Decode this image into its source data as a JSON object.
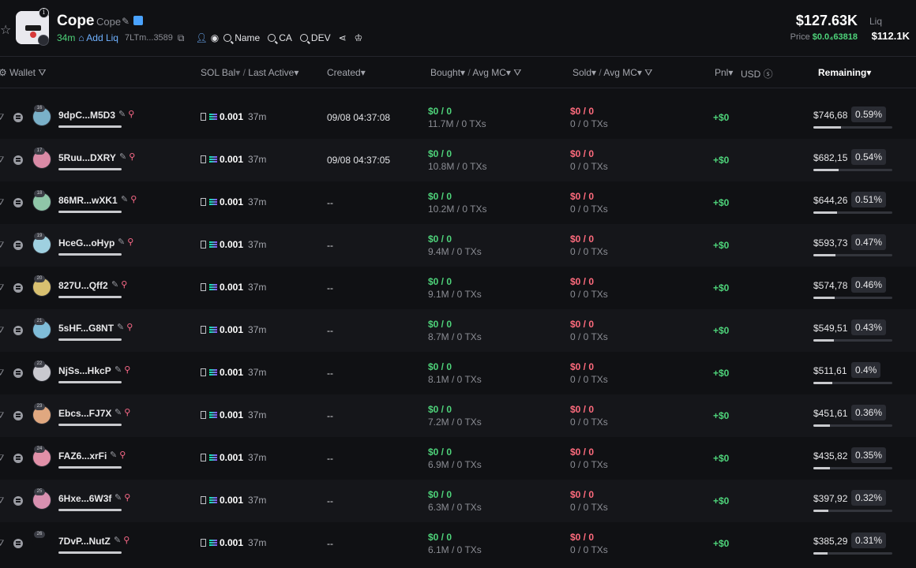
{
  "header": {
    "token_name": "Cope",
    "token_ticker": "Cope",
    "age": "34m",
    "add_liq": "Add Liq",
    "address": "7LTm...3589",
    "btn_name": "Name",
    "btn_ca": "CA",
    "btn_dev": "DEV",
    "market_cap": "$127.63K",
    "liq_label": "Liq",
    "price_label": "Price",
    "price_value": "$0.0₄63818",
    "liquidity": "$112.1K"
  },
  "columns": {
    "wallet": "Wallet",
    "sol_bal": "SOL Bal",
    "sep": "/",
    "last_active": "Last Active",
    "created": "Created",
    "bought": "Bought",
    "avg_mc": "Avg MC",
    "sold": "Sold",
    "pnl": "Pnl",
    "usd": "USD",
    "remaining": "Remaining"
  },
  "colors": {
    "positive": "#4ed37a",
    "negative": "#ff6b7d",
    "link": "#6fb1ff",
    "background": "#101114"
  },
  "rows": [
    {
      "rank": "16",
      "wallet": "9dpC...M5D3",
      "sol": "0.001",
      "active": "37m",
      "created": "09/08 04:37:08",
      "bought": "$0 / 0",
      "bought_sub": "11.7M / 0 TXs",
      "sold": "$0 / 0",
      "sold_sub": "0 / 0 TXs",
      "pnl": "+$0",
      "remaining": "$746,68",
      "pct": "0.59%",
      "fill": 0.59,
      "color": "#7ab0c8"
    },
    {
      "rank": "17",
      "wallet": "5Ruu...DXRY",
      "sol": "0.001",
      "active": "37m",
      "created": "09/08 04:37:05",
      "bought": "$0 / 0",
      "bought_sub": "10.8M / 0 TXs",
      "sold": "$0 / 0",
      "sold_sub": "0 / 0 TXs",
      "pnl": "+$0",
      "remaining": "$682,15",
      "pct": "0.54%",
      "fill": 0.54,
      "color": "#d98aa6"
    },
    {
      "rank": "18",
      "wallet": "86MR...wXK1",
      "sol": "0.001",
      "active": "37m",
      "created": "--",
      "bought": "$0 / 0",
      "bought_sub": "10.2M / 0 TXs",
      "sold": "$0 / 0",
      "sold_sub": "0 / 0 TXs",
      "pnl": "+$0",
      "remaining": "$644,26",
      "pct": "0.51%",
      "fill": 0.51,
      "color": "#8fc6a8"
    },
    {
      "rank": "19",
      "wallet": "HceG...oHyp",
      "sol": "0.001",
      "active": "37m",
      "created": "--",
      "bought": "$0 / 0",
      "bought_sub": "9.4M / 0 TXs",
      "sold": "$0 / 0",
      "sold_sub": "0 / 0 TXs",
      "pnl": "+$0",
      "remaining": "$593,73",
      "pct": "0.47%",
      "fill": 0.47,
      "color": "#9fd0e0"
    },
    {
      "rank": "20",
      "wallet": "827U...Qff2",
      "sol": "0.001",
      "active": "37m",
      "created": "--",
      "bought": "$0 / 0",
      "bought_sub": "9.1M / 0 TXs",
      "sold": "$0 / 0",
      "sold_sub": "0 / 0 TXs",
      "pnl": "+$0",
      "remaining": "$574,78",
      "pct": "0.46%",
      "fill": 0.46,
      "color": "#d8c070"
    },
    {
      "rank": "21",
      "wallet": "5sHF...G8NT",
      "sol": "0.001",
      "active": "37m",
      "created": "--",
      "bought": "$0 / 0",
      "bought_sub": "8.7M / 0 TXs",
      "sold": "$0 / 0",
      "sold_sub": "0 / 0 TXs",
      "pnl": "+$0",
      "remaining": "$549,51",
      "pct": "0.43%",
      "fill": 0.43,
      "color": "#7fbcd8"
    },
    {
      "rank": "22",
      "wallet": "NjSs...HkcP",
      "sol": "0.001",
      "active": "37m",
      "created": "--",
      "bought": "$0 / 0",
      "bought_sub": "8.1M / 0 TXs",
      "sold": "$0 / 0",
      "sold_sub": "0 / 0 TXs",
      "pnl": "+$0",
      "remaining": "$511,61",
      "pct": "0.4%",
      "fill": 0.4,
      "color": "#c9c9cf"
    },
    {
      "rank": "23",
      "wallet": "Ebcs...FJ7X",
      "sol": "0.001",
      "active": "37m",
      "created": "--",
      "bought": "$0 / 0",
      "bought_sub": "7.2M / 0 TXs",
      "sold": "$0 / 0",
      "sold_sub": "0 / 0 TXs",
      "pnl": "+$0",
      "remaining": "$451,61",
      "pct": "0.36%",
      "fill": 0.36,
      "color": "#e0a880"
    },
    {
      "rank": "24",
      "wallet": "FAZ6...xrFi",
      "sol": "0.001",
      "active": "37m",
      "created": "--",
      "bought": "$0 / 0",
      "bought_sub": "6.9M / 0 TXs",
      "sold": "$0 / 0",
      "sold_sub": "0 / 0 TXs",
      "pnl": "+$0",
      "remaining": "$435,82",
      "pct": "0.35%",
      "fill": 0.35,
      "color": "#e090a8"
    },
    {
      "rank": "25",
      "wallet": "6Hxe...6W3f",
      "sol": "0.001",
      "active": "37m",
      "created": "--",
      "bought": "$0 / 0",
      "bought_sub": "6.3M / 0 TXs",
      "sold": "$0 / 0",
      "sold_sub": "0 / 0 TXs",
      "pnl": "+$0",
      "remaining": "$397,92",
      "pct": "0.32%",
      "fill": 0.32,
      "color": "#d890b0"
    },
    {
      "rank": "26",
      "wallet": "7DvP...NutZ",
      "sol": "0.001",
      "active": "37m",
      "created": "--",
      "bought": "$0 / 0",
      "bought_sub": "6.1M / 0 TXs",
      "sold": "$0 / 0",
      "sold_sub": "0 / 0 TXs",
      "pnl": "+$0",
      "remaining": "$385,29",
      "pct": "0.31%",
      "fill": 0.31,
      "color": "#101114"
    }
  ]
}
